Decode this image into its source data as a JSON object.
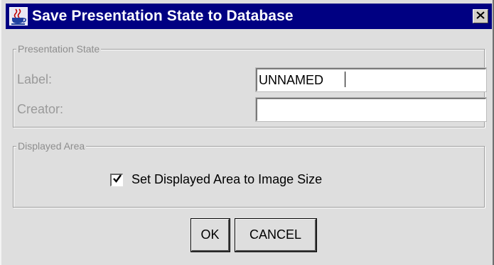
{
  "window": {
    "title": "Save Presentation State to Database",
    "app_icon": "java-cup-icon",
    "close_icon": "close-icon"
  },
  "presentation_state": {
    "legend": "Presentation State",
    "label_caption": "Label:",
    "label_value": "UNNAMED",
    "creator_caption": "Creator:",
    "creator_value": ""
  },
  "displayed_area": {
    "legend": "Displayed Area",
    "checkbox_label": "Set Displayed Area to Image Size",
    "checked": true
  },
  "buttons": {
    "ok_label": "OK",
    "cancel_label": "CANCEL"
  }
}
